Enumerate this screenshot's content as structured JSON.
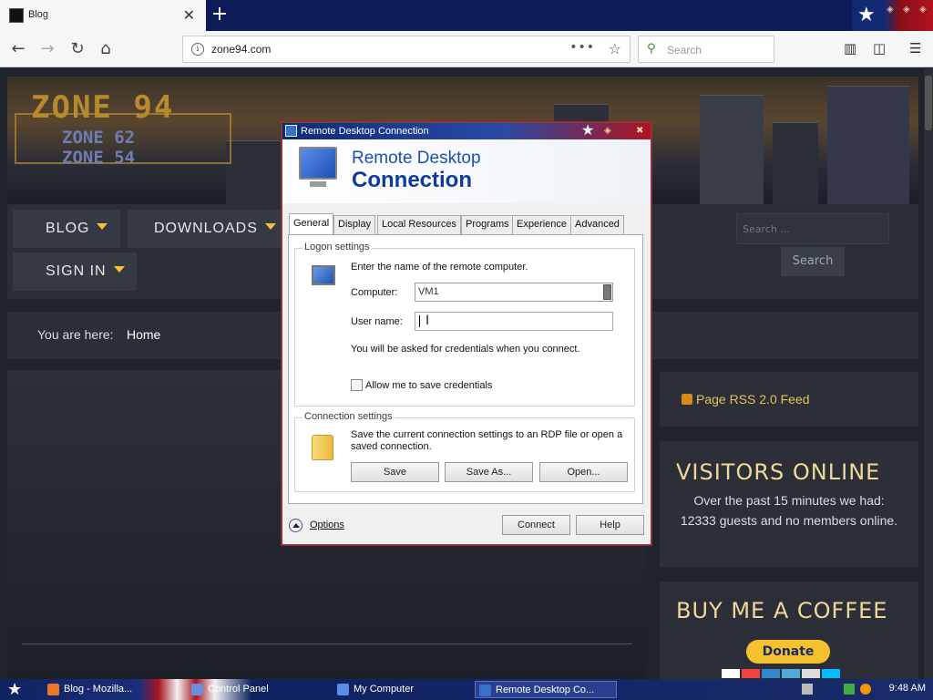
{
  "browser": {
    "tab_title": "Blog",
    "url": "zone94.com",
    "search_placeholder": "Search"
  },
  "site": {
    "logo_main": "ZONE 94",
    "logo_sub1": "ZONE 62",
    "logo_sub2": "ZONE 54",
    "menu": [
      {
        "label": "BLOG"
      },
      {
        "label": "DOWNLOADS"
      },
      {
        "label": "SIGN IN"
      }
    ],
    "search_placeholder": "Search ...",
    "search_button": "Search",
    "breadcrumb_label": "You are here:",
    "breadcrumb_current": "Home",
    "rss_link": "Page RSS 2.0 Feed",
    "visitors_heading": "VISITORS ONLINE",
    "visitors_text": "Over the past 15 minutes we had: 12333 guests and no members online.",
    "coffee_heading": "BUY ME A COFFEE",
    "donate_label": "Donate"
  },
  "dialog": {
    "title": "Remote Desktop Connection",
    "header_line1": "Remote Desktop",
    "header_line2": "Connection",
    "tabs": [
      "General",
      "Display",
      "Local Resources",
      "Programs",
      "Experience",
      "Advanced"
    ],
    "logon_group": "Logon settings",
    "logon_intro": "Enter the name of the remote computer.",
    "computer_label": "Computer:",
    "computer_value": "VM1",
    "username_label": "User name:",
    "username_value": "",
    "credentials_note": "You will be asked for credentials when you connect.",
    "save_credentials_label": "Allow me to save credentials",
    "connection_group": "Connection settings",
    "connection_text": "Save the current connection settings to an RDP file or open a saved connection.",
    "save_button": "Save",
    "save_as_button": "Save As...",
    "open_button": "Open...",
    "options_label": "Options",
    "connect_button": "Connect",
    "help_button": "Help"
  },
  "taskbar": {
    "items": [
      {
        "label": "Blog - Mozilla..."
      },
      {
        "label": "Control Panel"
      },
      {
        "label": "My Computer"
      },
      {
        "label": "Remote Desktop Co..."
      }
    ],
    "clock": "9:48 AM"
  },
  "colors": {
    "accent": "#f4c230",
    "dialog_blue": "#1d4fb8",
    "flag_red": "#b0121f",
    "flag_blue": "#0d2a7a"
  }
}
